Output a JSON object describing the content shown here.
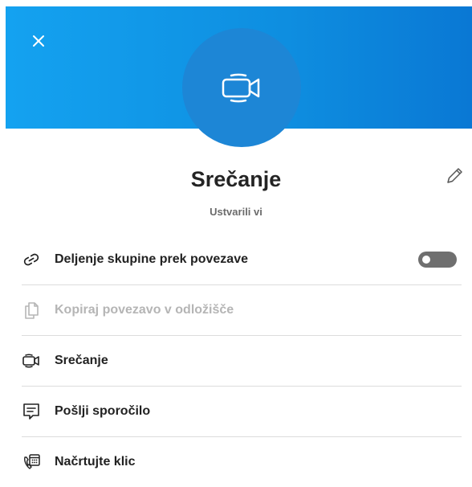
{
  "header": {
    "accent_gradient": [
      "#14a2f0",
      "#0a78d4"
    ],
    "close_icon": "close-icon",
    "avatar_icon": "video-camera-icon",
    "avatar_color": "#1d86d6"
  },
  "profile": {
    "title": "Srečanje",
    "subtitle": "Ustvarili vi",
    "edit_icon": "pencil-icon"
  },
  "menu": {
    "items": [
      {
        "label": "Deljenje skupine prek povezave",
        "icon": "link-icon",
        "enabled": true,
        "toggle": {
          "on": false
        }
      },
      {
        "label": "Kopiraj povezavo v odložišče",
        "icon": "copy-icon",
        "enabled": false
      },
      {
        "label": "Srečanje",
        "icon": "video-camera-icon",
        "enabled": true
      },
      {
        "label": "Pošlji sporočilo",
        "icon": "chat-icon",
        "enabled": true
      },
      {
        "label": "Načrtujte klic",
        "icon": "schedule-call-icon",
        "enabled": true
      }
    ]
  }
}
